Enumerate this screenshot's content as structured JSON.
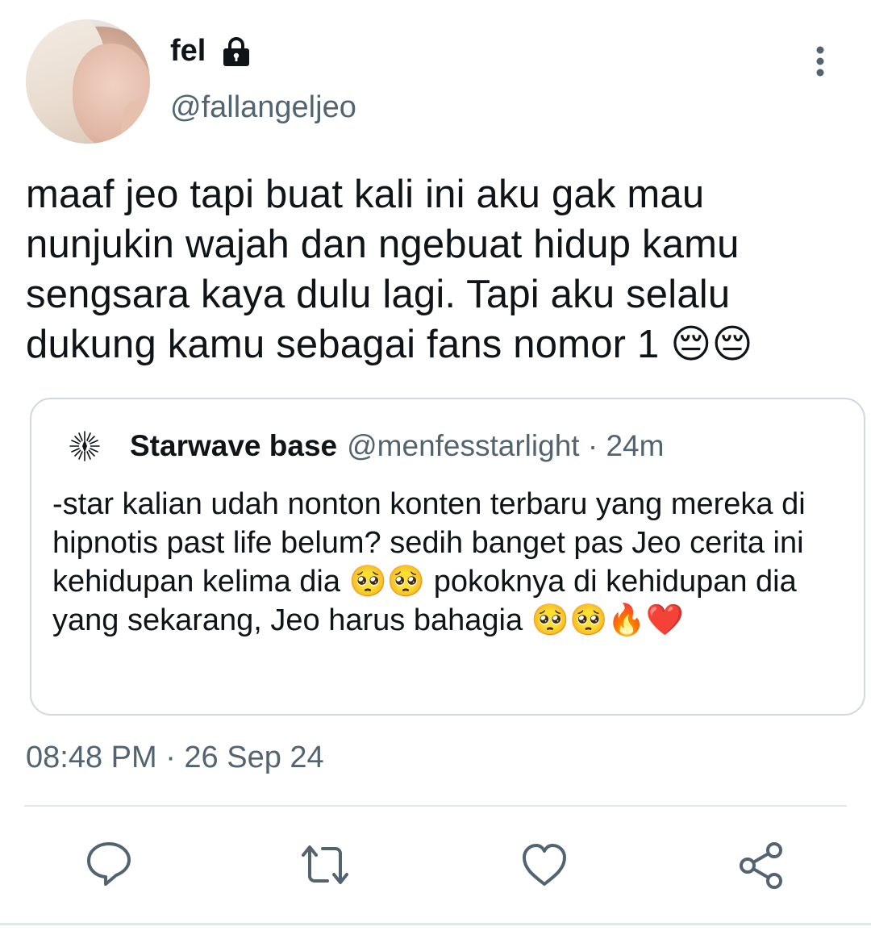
{
  "author": {
    "display_name": "fel",
    "handle": "@fallangeljeo"
  },
  "tweet": {
    "text": "maaf jeo tapi buat kali ini aku gak mau nunjukin wajah dan ngebuat hidup kamu sengsara kaya dulu lagi. Tapi aku selalu dukung kamu sebagai fans nomor 1 😔😔"
  },
  "quoted_tweet": {
    "display_name": "Starwave base",
    "meta": "@menfesstarlight · 24m",
    "text": "-star kalian udah nonton konten terbaru yang mereka di hipnotis past life belum? sedih banget pas Jeo cerita ini kehidupan kelima dia 🥺🥺 pokoknya di kehidupan dia yang sekarang, Jeo harus bahagia 🥺🥺🔥❤️"
  },
  "timestamp": "08:48 PM · 26 Sep 24",
  "icons": {
    "lock": "lock-icon",
    "more": "more-vertical-icon",
    "reply": "reply-icon",
    "retweet": "retweet-icon",
    "like": "heart-icon",
    "share": "share-icon"
  },
  "colors": {
    "text": "#0f1419",
    "secondary": "#536471",
    "border": "#cfd9de",
    "icon": "#536471"
  }
}
